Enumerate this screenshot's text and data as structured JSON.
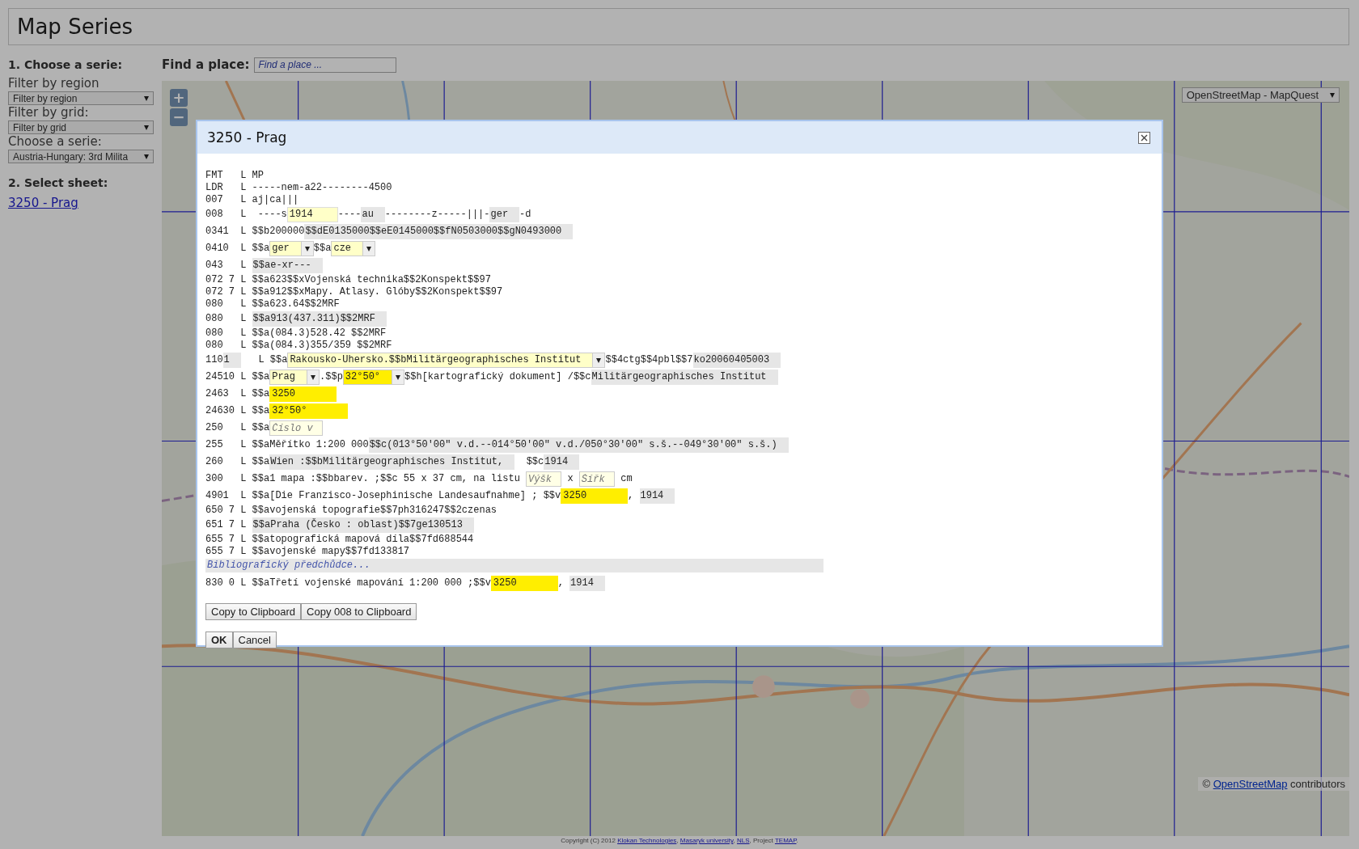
{
  "header": {
    "title": "Map Series"
  },
  "sidebar": {
    "step1": "1. Choose a serie:",
    "filters": [
      {
        "label": "Filter by region",
        "value": "Filter by region"
      },
      {
        "label": "Filter by grid:",
        "value": "Filter by grid"
      },
      {
        "label": "Choose a serie:",
        "value": "Austria-Hungary: 3rd Milita"
      }
    ],
    "step2": "2. Select sheet:",
    "sheets": [
      {
        "label": "3250 - Prag"
      }
    ]
  },
  "search": {
    "label": "Find a place:",
    "placeholder": "Find a place ..."
  },
  "map": {
    "kind": "picture",
    "layer_select": "OpenStreetMap - MapQuest",
    "zoom_in": "+",
    "zoom_out": "−",
    "attribution": {
      "prefix": "©",
      "link": "OpenStreetMap",
      "suffix": "contributors"
    }
  },
  "dialog": {
    "title": "3250 - Prag",
    "lines": [
      [
        {
          "kind": "text",
          "text": "FMT   L MP"
        }
      ],
      [
        {
          "kind": "text",
          "text": "LDR   L -----nem-a22--------4500"
        }
      ],
      [
        {
          "kind": "text",
          "text": "007   L aj|ca|||"
        }
      ],
      [
        {
          "kind": "text",
          "text": "008   L  ----s"
        },
        {
          "kind": "input",
          "text": "1914"
        },
        {
          "kind": "text",
          "text": "----"
        },
        {
          "kind": "shade",
          "text": "au"
        },
        {
          "kind": "text",
          "text": "--------z-----|||-"
        },
        {
          "kind": "shade",
          "text": "ger"
        },
        {
          "kind": "text",
          "text": "-d"
        }
      ],
      [
        {
          "kind": "text",
          "text": "0341  L $$b200000"
        },
        {
          "kind": "shade",
          "text": "$$dE0135000$$eE0145000$$fN0503000$$gN0493000"
        }
      ],
      [
        {
          "kind": "text",
          "text": "0410  L $$a"
        },
        {
          "kind": "select",
          "text": "ger"
        },
        {
          "kind": "text",
          "text": "$$a"
        },
        {
          "kind": "select",
          "text": "cze"
        }
      ],
      [
        {
          "kind": "text",
          "text": "043   L "
        },
        {
          "kind": "shade",
          "text": "$$ae-xr---"
        }
      ],
      [
        {
          "kind": "text",
          "text": "072 7 L $$a623$$xVojenská technika$$2Konspekt$$97"
        }
      ],
      [
        {
          "kind": "text",
          "text": "072 7 L $$a912$$xMapy. Atlasy. Glóby$$2Konspekt$$97"
        }
      ],
      [
        {
          "kind": "text",
          "text": "080   L $$a623.64$$2MRF"
        }
      ],
      [
        {
          "kind": "text",
          "text": "080   L "
        },
        {
          "kind": "shade",
          "text": "$$a913(437.311)$$2MRF"
        }
      ],
      [
        {
          "kind": "text",
          "text": "080   L $$a(084.3)528.42 $$2MRF"
        }
      ],
      [
        {
          "kind": "text",
          "text": "080   L $$a(084.3)355/359 $$2MRF"
        }
      ],
      [
        {
          "kind": "text",
          "text": "110"
        },
        {
          "kind": "shade",
          "text": "1"
        },
        {
          "kind": "text",
          "text": "   L $$a"
        },
        {
          "kind": "select",
          "text": "Rakousko-Uhersko.$$bMilitärgeographisches Institut"
        },
        {
          "kind": "text",
          "text": "$$4ctg$$4pbl$$7"
        },
        {
          "kind": "shade",
          "text": "ko20060405003"
        }
      ],
      [
        {
          "kind": "text",
          "text": "24510 L $$a"
        },
        {
          "kind": "select",
          "text": "Prag"
        },
        {
          "kind": "text",
          "text": ".$$p"
        },
        {
          "kind": "select-mark",
          "text": "32°50°"
        },
        {
          "kind": "text",
          "text": "$$h[kartografický dokument] /$$c"
        },
        {
          "kind": "shade",
          "text": "Militärgeographisches Institut"
        }
      ],
      [
        {
          "kind": "text",
          "text": "2463  L $$a"
        },
        {
          "kind": "mark",
          "text": "3250"
        }
      ],
      [
        {
          "kind": "text",
          "text": "24630 L $$a"
        },
        {
          "kind": "mark",
          "text": "32°50°"
        }
      ],
      [
        {
          "kind": "text",
          "text": "250   L $$a"
        },
        {
          "kind": "hint",
          "placeholder": "Číslo v"
        }
      ],
      [
        {
          "kind": "text",
          "text": "255   L $$aMěřítko 1:200 000"
        },
        {
          "kind": "shade",
          "text": "$$c(013°50'00\" v.d.--014°50'00\" v.d./050°30'00\" s.š.--049°30'00\" s.š.)"
        }
      ],
      [
        {
          "kind": "text",
          "text": "260   L $$a"
        },
        {
          "kind": "shade",
          "text": "Wien :$$bMilitärgeographisches Institut,"
        },
        {
          "kind": "text",
          "text": "  $$c"
        },
        {
          "kind": "shade",
          "text": "1914"
        }
      ],
      [
        {
          "kind": "text",
          "text": "300   L $$a1 mapa :$$bbarev. ;$$c 55 x 37 cm, na listu "
        },
        {
          "kind": "hint",
          "placeholder": "Výšk"
        },
        {
          "kind": "text",
          "text": " x "
        },
        {
          "kind": "hint",
          "placeholder": "Šířk"
        },
        {
          "kind": "text",
          "text": " cm"
        }
      ],
      [
        {
          "kind": "text",
          "text": "4901  L $$a[Die Franzisco-Josephinische Landesaufnahme] ; $$v"
        },
        {
          "kind": "mark",
          "text": "3250"
        },
        {
          "kind": "text",
          "text": ", "
        },
        {
          "kind": "shade",
          "text": "1914"
        }
      ],
      [
        {
          "kind": "text",
          "text": "650 7 L $$avojenská topografie$$7ph316247$$2czenas"
        }
      ],
      [
        {
          "kind": "text",
          "text": "651 7 L "
        },
        {
          "kind": "shade",
          "text": "$$aPraha (Česko : oblast)$$7ge130513"
        }
      ],
      [
        {
          "kind": "text",
          "text": "655 7 L $$atopografická mapová díla$$7fd688544"
        }
      ],
      [
        {
          "kind": "text",
          "text": "655 7 L $$avojenské mapy$$7fd133817"
        }
      ],
      [
        {
          "kind": "link",
          "text": "Bibliografický předchůdce..."
        }
      ],
      [
        {
          "kind": "text",
          "text": "830 0 L $$aTřetí vojenské mapování 1:200 000 ;$$v"
        },
        {
          "kind": "mark",
          "text": "3250"
        },
        {
          "kind": "text",
          "text": ", "
        },
        {
          "kind": "shade",
          "text": "1914"
        }
      ]
    ],
    "copy_buttons": [
      "Copy to Clipboard",
      "Copy 008 to Clipboard"
    ],
    "buttons": [
      "OK",
      "Cancel"
    ]
  },
  "footer": [
    {
      "kind": "text",
      "text": "Copyright (C) 2012 "
    },
    {
      "kind": "link",
      "text": "Klokan Technologies"
    },
    {
      "kind": "text",
      "text": ", "
    },
    {
      "kind": "link",
      "text": "Masaryk university"
    },
    {
      "kind": "text",
      "text": ", "
    },
    {
      "kind": "link",
      "text": "NLS"
    },
    {
      "kind": "text",
      "text": ", Project "
    },
    {
      "kind": "link",
      "text": "TEMAP"
    },
    {
      "kind": "text",
      "text": "."
    }
  ]
}
